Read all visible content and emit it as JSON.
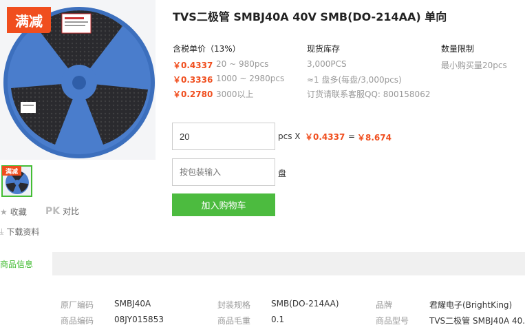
{
  "product": {
    "badge": "满减",
    "thumb_badge": "满减",
    "title": "TVS二极管 SMBJ40A 40V SMB(DO-214AA) 单向"
  },
  "side_actions": {
    "favorite": "收藏",
    "pk_mark": "PK",
    "compare": "对比",
    "download": "下载资料"
  },
  "pricing": {
    "header": "含税单价（13%）",
    "tiers": [
      {
        "price": "￥0.4337",
        "range": "20 ~ 980pcs"
      },
      {
        "price": "￥0.3336",
        "range": "1000 ~ 2980pcs"
      },
      {
        "price": "￥0.2780",
        "range": "3000以上"
      }
    ]
  },
  "stock": {
    "header": "现货库存",
    "quantity": "3,000PCS",
    "reel": "≈1 盘多(每盘/3,000pcs)",
    "contact": "订货请联系客服QQ: 800158062"
  },
  "limit": {
    "header": "数量限制",
    "min": "最小购买量20pcs"
  },
  "order": {
    "qty_value": "20",
    "unit": "pcs X",
    "unit_price": "￥0.4337",
    "equals": "=",
    "total": "￥8.674",
    "pack_placeholder": "按包装输入",
    "pack_unit": "盘",
    "cart_button": "加入购物车"
  },
  "tabs": {
    "active": "商品信息"
  },
  "info": {
    "rows": [
      [
        {
          "label": "原厂编码",
          "value": "SMBJ40A"
        },
        {
          "label": "封装规格",
          "value": "SMB(DO-214AA)"
        },
        {
          "label": "品牌",
          "value": "君耀电子(BrightKing)"
        }
      ],
      [
        {
          "label": "商品编码",
          "value": "08JY015853"
        },
        {
          "label": "商品毛重",
          "value": "0.1"
        },
        {
          "label": "商品型号",
          "value": "TVS二极管 SMBJ40A 40..."
        }
      ]
    ]
  },
  "colors": {
    "accent_orange": "#f04e1e",
    "accent_green": "#4cbb3f",
    "reel_blue": "#3f74c2"
  }
}
